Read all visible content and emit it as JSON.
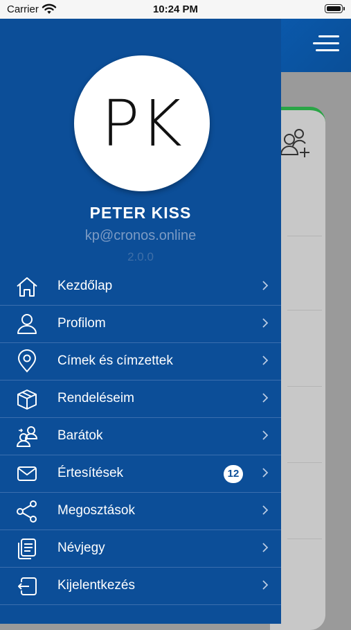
{
  "status_bar": {
    "carrier": "Carrier",
    "time": "10:24 PM"
  },
  "profile": {
    "initials": "PK",
    "name": "PETER KISS",
    "email": "kp@cronos.online",
    "version": "2.0.0"
  },
  "menu": [
    {
      "label": "Kezdőlap",
      "icon": "home-icon"
    },
    {
      "label": "Profilom",
      "icon": "user-icon"
    },
    {
      "label": "Címek és címzettek",
      "icon": "location-pin-icon"
    },
    {
      "label": "Rendeléseim",
      "icon": "package-icon"
    },
    {
      "label": "Barátok",
      "icon": "friends-icon"
    },
    {
      "label": "Értesítések",
      "icon": "mail-icon",
      "badge": "12"
    },
    {
      "label": "Megosztások",
      "icon": "share-icon"
    },
    {
      "label": "Névjegy",
      "icon": "document-icon"
    },
    {
      "label": "Kijelentkezés",
      "icon": "logout-icon"
    }
  ],
  "colors": {
    "drawer": "#0c4e98",
    "divider": "#3b6fae",
    "accent_green": "#2aa546"
  }
}
